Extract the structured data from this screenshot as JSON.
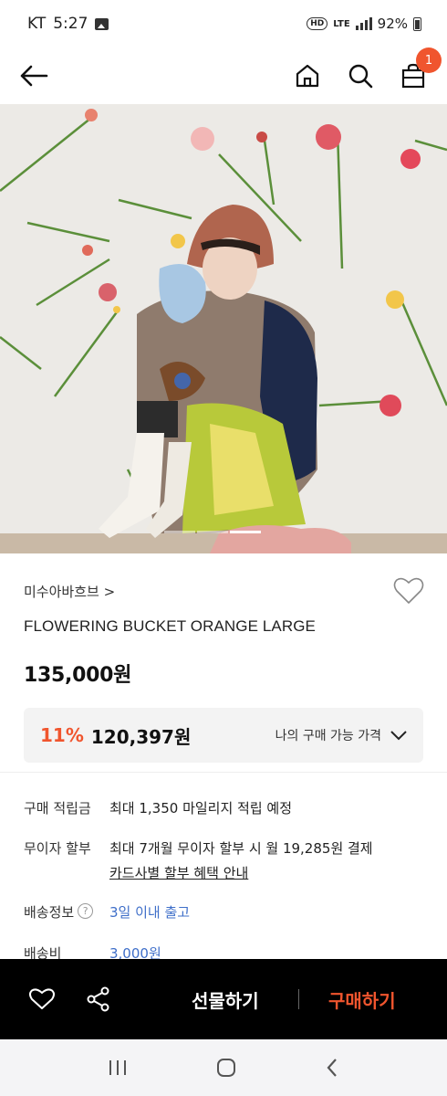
{
  "status_bar": {
    "carrier": "KT",
    "time": "5:27",
    "network": "LTE",
    "battery": "92%"
  },
  "product": {
    "brand": "미수아바흐브 >",
    "name": "FLOWERING BUCKET ORANGE LARGE",
    "price": "135,000원",
    "discount_rate": "11%",
    "my_price": "120,397원",
    "my_price_label": "나의 구매 가능 가격"
  },
  "details": {
    "points_label": "구매 적립금",
    "points_value": "최대 1,350 마일리지 적립 예정",
    "installment_label": "무이자 할부",
    "installment_value": "최대 7개월 무이자 할부 시 월 19,285원 결제",
    "installment_link": "카드사별 할부 혜택 안내",
    "shipping_label": "배송정보",
    "shipping_value": "3일 이내 출고",
    "shipping_fee_label": "배송비",
    "shipping_fee_value": "3,000원"
  },
  "bottom_bar": {
    "gift_label": "선물하기",
    "buy_label": "구매하기"
  },
  "cart": {
    "count": "1"
  },
  "colors": {
    "accent": "#f0552e",
    "link": "#3f6fc9"
  }
}
